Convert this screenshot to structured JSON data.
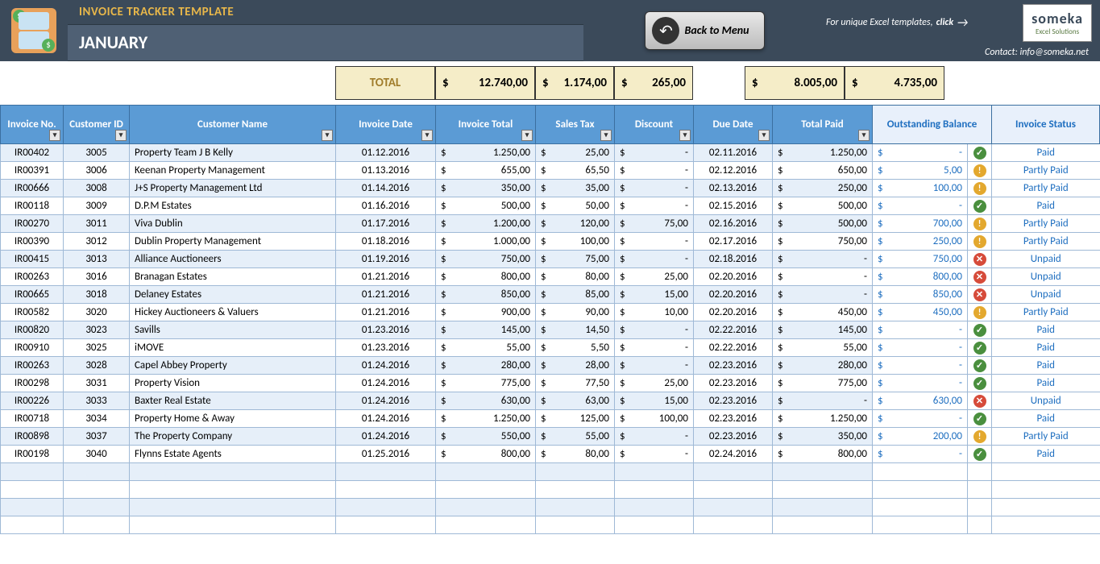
{
  "header": {
    "title": "INVOICE TRACKER TEMPLATE",
    "month": "JANUARY",
    "back_button": "Back to Menu",
    "promo_text": "For unique Excel templates,",
    "promo_click": "click",
    "contact": "Contact: info@someka.net",
    "logo_big": "someka",
    "logo_small": "Excel Solutions"
  },
  "totals": {
    "label": "TOTAL",
    "currency": "$",
    "invoice_total": "12.740,00",
    "sales_tax": "1.174,00",
    "discount": "265,00",
    "total_paid": "8.005,00",
    "outstanding": "4.735,00"
  },
  "headers": {
    "invoice_no": "Invoice No.",
    "customer_id": "Customer ID",
    "customer_name": "Customer Name",
    "invoice_date": "Invoice Date",
    "invoice_total": "Invoice Total",
    "sales_tax": "Sales Tax",
    "discount": "Discount",
    "due_date": "Due Date",
    "total_paid": "Total Paid",
    "outstanding_balance": "Outstanding Balance",
    "invoice_status": "Invoice Status"
  },
  "rows": [
    {
      "no": "IR00402",
      "cid": "3005",
      "name": "Property Team J B Kelly",
      "date": "01.12.2016",
      "total": "1.250,00",
      "tax": "25,00",
      "disc": "-",
      "due": "02.11.2016",
      "paid": "1.250,00",
      "ob": "-",
      "status": "Paid",
      "icon": "green"
    },
    {
      "no": "IR00391",
      "cid": "3006",
      "name": "Keenan Property Management",
      "date": "01.13.2016",
      "total": "655,00",
      "tax": "65,50",
      "disc": "-",
      "due": "02.12.2016",
      "paid": "650,00",
      "ob": "5,00",
      "status": "Partly Paid",
      "icon": "orange"
    },
    {
      "no": "IR00666",
      "cid": "3008",
      "name": "J+S Property Management Ltd",
      "date": "01.14.2016",
      "total": "350,00",
      "tax": "35,00",
      "disc": "-",
      "due": "02.13.2016",
      "paid": "250,00",
      "ob": "100,00",
      "status": "Partly Paid",
      "icon": "orange"
    },
    {
      "no": "IR00118",
      "cid": "3009",
      "name": "D.P.M Estates",
      "date": "01.16.2016",
      "total": "500,00",
      "tax": "50,00",
      "disc": "-",
      "due": "02.15.2016",
      "paid": "500,00",
      "ob": "-",
      "status": "Paid",
      "icon": "green"
    },
    {
      "no": "IR00270",
      "cid": "3011",
      "name": "Viva Dublin",
      "date": "01.17.2016",
      "total": "1.200,00",
      "tax": "120,00",
      "disc": "75,00",
      "due": "02.16.2016",
      "paid": "500,00",
      "ob": "700,00",
      "status": "Partly Paid",
      "icon": "orange"
    },
    {
      "no": "IR00390",
      "cid": "3012",
      "name": "Dublin Property Management",
      "date": "01.18.2016",
      "total": "1.000,00",
      "tax": "100,00",
      "disc": "-",
      "due": "02.17.2016",
      "paid": "750,00",
      "ob": "250,00",
      "status": "Partly Paid",
      "icon": "orange"
    },
    {
      "no": "IR00415",
      "cid": "3013",
      "name": "Alliance Auctioneers",
      "date": "01.19.2016",
      "total": "750,00",
      "tax": "75,00",
      "disc": "-",
      "due": "02.18.2016",
      "paid": "-",
      "ob": "750,00",
      "status": "Unpaid",
      "icon": "red"
    },
    {
      "no": "IR00263",
      "cid": "3016",
      "name": "Branagan Estates",
      "date": "01.21.2016",
      "total": "800,00",
      "tax": "80,00",
      "disc": "25,00",
      "due": "02.20.2016",
      "paid": "-",
      "ob": "800,00",
      "status": "Unpaid",
      "icon": "red"
    },
    {
      "no": "IR00665",
      "cid": "3018",
      "name": "Delaney Estates",
      "date": "01.21.2016",
      "total": "850,00",
      "tax": "85,00",
      "disc": "15,00",
      "due": "02.20.2016",
      "paid": "-",
      "ob": "850,00",
      "status": "Unpaid",
      "icon": "red"
    },
    {
      "no": "IR00582",
      "cid": "3020",
      "name": "Hickey Auctioneers & Valuers",
      "date": "01.21.2016",
      "total": "900,00",
      "tax": "90,00",
      "disc": "10,00",
      "due": "02.20.2016",
      "paid": "450,00",
      "ob": "450,00",
      "status": "Partly Paid",
      "icon": "orange"
    },
    {
      "no": "IR00820",
      "cid": "3023",
      "name": "Savills",
      "date": "01.23.2016",
      "total": "145,00",
      "tax": "14,50",
      "disc": "-",
      "due": "02.22.2016",
      "paid": "145,00",
      "ob": "-",
      "status": "Paid",
      "icon": "green"
    },
    {
      "no": "IR00910",
      "cid": "3025",
      "name": "iMOVE",
      "date": "01.23.2016",
      "total": "55,00",
      "tax": "5,50",
      "disc": "-",
      "due": "02.22.2016",
      "paid": "55,00",
      "ob": "-",
      "status": "Paid",
      "icon": "green"
    },
    {
      "no": "IR00263",
      "cid": "3028",
      "name": "Capel Abbey Property",
      "date": "01.24.2016",
      "total": "280,00",
      "tax": "28,00",
      "disc": "-",
      "due": "02.23.2016",
      "paid": "280,00",
      "ob": "-",
      "status": "Paid",
      "icon": "green"
    },
    {
      "no": "IR00298",
      "cid": "3031",
      "name": "Property Vision",
      "date": "01.24.2016",
      "total": "775,00",
      "tax": "77,50",
      "disc": "25,00",
      "due": "02.23.2016",
      "paid": "775,00",
      "ob": "-",
      "status": "Paid",
      "icon": "green"
    },
    {
      "no": "IR00226",
      "cid": "3033",
      "name": "Baxter Real Estate",
      "date": "01.24.2016",
      "total": "630,00",
      "tax": "63,00",
      "disc": "15,00",
      "due": "02.23.2016",
      "paid": "-",
      "ob": "630,00",
      "status": "Unpaid",
      "icon": "red"
    },
    {
      "no": "IR00718",
      "cid": "3034",
      "name": "Property Home & Away",
      "date": "01.24.2016",
      "total": "1.250,00",
      "tax": "125,00",
      "disc": "100,00",
      "due": "02.23.2016",
      "paid": "1.250,00",
      "ob": "-",
      "status": "Paid",
      "icon": "green"
    },
    {
      "no": "IR00898",
      "cid": "3037",
      "name": "The Property Company",
      "date": "01.24.2016",
      "total": "550,00",
      "tax": "55,00",
      "disc": "-",
      "due": "02.23.2016",
      "paid": "350,00",
      "ob": "200,00",
      "status": "Partly Paid",
      "icon": "orange"
    },
    {
      "no": "IR00198",
      "cid": "3040",
      "name": "Flynns Estate Agents",
      "date": "01.25.2016",
      "total": "800,00",
      "tax": "80,00",
      "disc": "-",
      "due": "02.24.2016",
      "paid": "800,00",
      "ob": "-",
      "status": "Paid",
      "icon": "green"
    }
  ],
  "empty_rows": 4
}
